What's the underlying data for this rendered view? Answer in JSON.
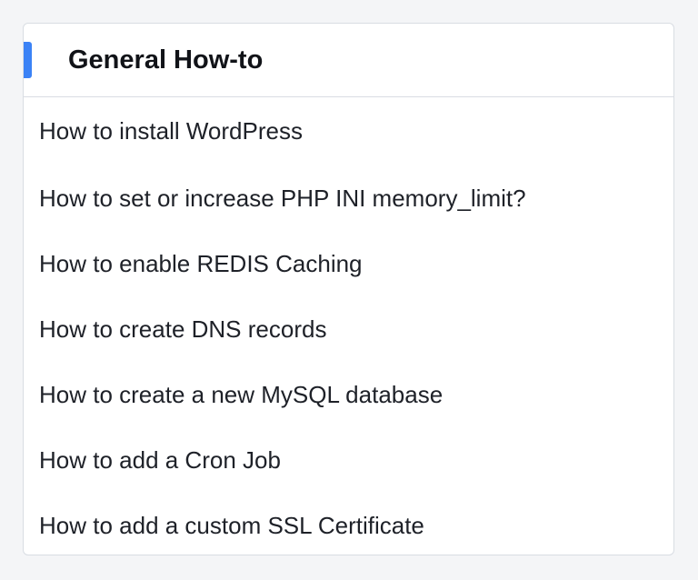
{
  "card": {
    "title": "General How-to",
    "accent_color": "#3b82f6",
    "links": [
      {
        "label": "How to install WordPress"
      },
      {
        "label": "How to set or increase PHP INI memory_limit?"
      },
      {
        "label": "How to enable REDIS Caching"
      },
      {
        "label": "How to create DNS records"
      },
      {
        "label": "How to create a new MySQL database"
      },
      {
        "label": "How to add a Cron Job"
      },
      {
        "label": "How to add a custom SSL Certificate"
      }
    ]
  }
}
